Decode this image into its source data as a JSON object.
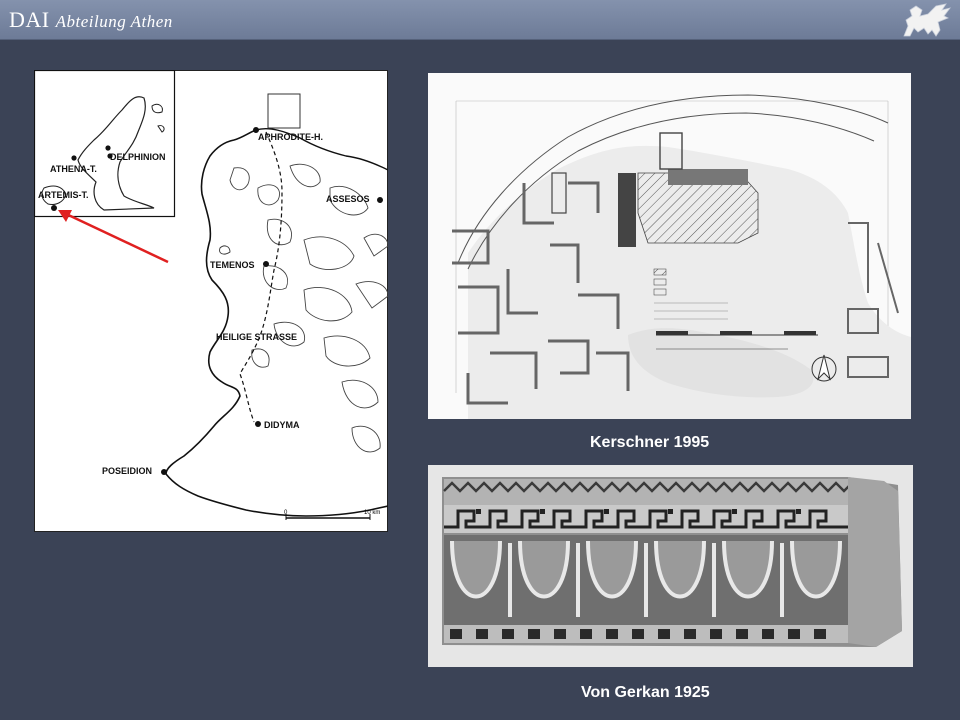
{
  "header": {
    "title": "DAI",
    "subtitle": "Abteilung Athen",
    "logo_icon": "griffin-logo-icon"
  },
  "map": {
    "places": {
      "aphrodite": "APHRODITE-H.",
      "delphinion": "DELPHINION",
      "athena": "ATHENA-T.",
      "artemis": "ARTEMIS-T.",
      "assesos": "ASSESOS",
      "temenos": "TEMENOS",
      "heilige": "HEILIGE STRASSE",
      "didyma": "DIDYMA",
      "poseidion": "POSEIDION"
    },
    "scale": {
      "start": "0",
      "end": "10 km"
    },
    "arrow_color": "#e02020"
  },
  "captions": {
    "plan": "Kerschner 1995",
    "photo": "Von Gerkan 1925"
  }
}
